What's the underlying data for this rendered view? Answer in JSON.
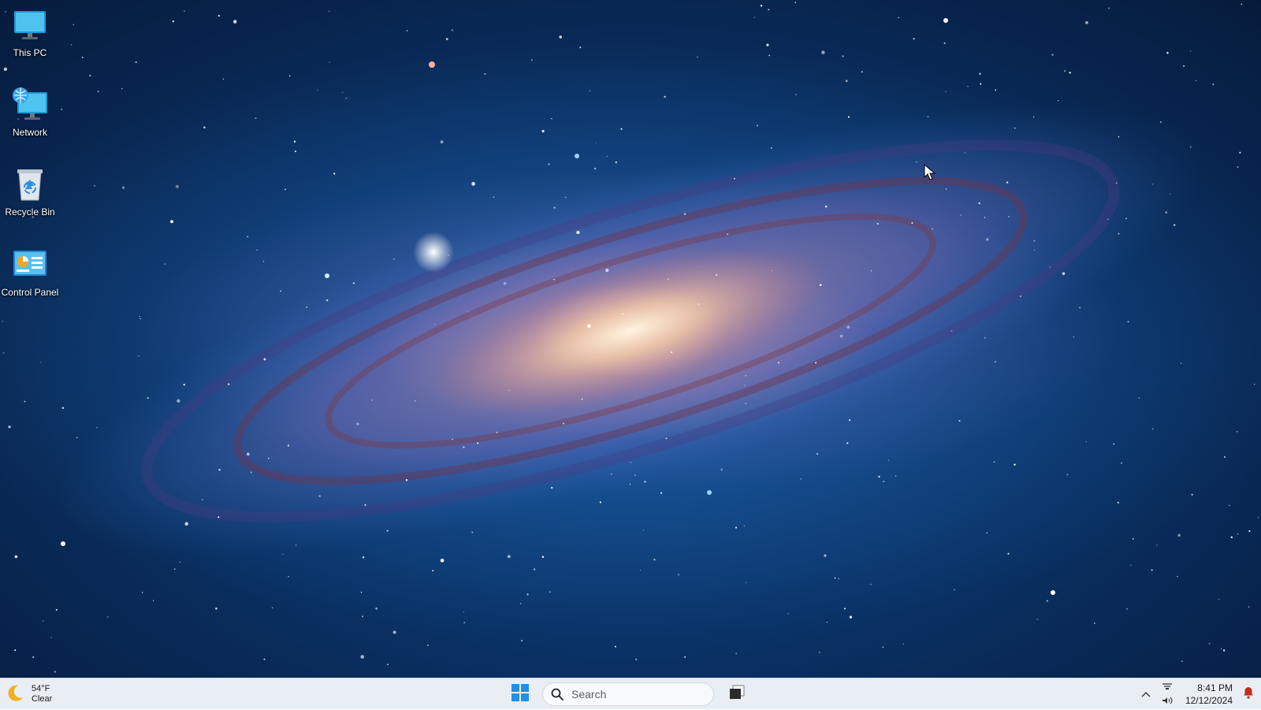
{
  "desktop": {
    "icons": [
      {
        "name": "this-pc",
        "label": "This PC",
        "icon": "monitor-icon"
      },
      {
        "name": "network",
        "label": "Network",
        "icon": "network-icon"
      },
      {
        "name": "recycle-bin",
        "label": "Recycle Bin",
        "icon": "recycle-bin-icon"
      },
      {
        "name": "control-panel",
        "label": "Control Panel",
        "icon": "control-panel-icon"
      }
    ]
  },
  "taskbar": {
    "weather": {
      "temperature": "54°F",
      "condition": "Clear",
      "icon": "moon-icon"
    },
    "start_icon": "windows-logo-icon",
    "search": {
      "placeholder": "Search",
      "value": ""
    },
    "task_view_icon": "task-view-icon",
    "tray": {
      "overflow_icon": "chevron-up-icon",
      "network_icon": "network-status-icon",
      "volume_icon": "volume-icon",
      "notification_icon": "bell-icon"
    },
    "clock": {
      "time": "8:41 PM",
      "date": "12/12/2024"
    }
  },
  "colors": {
    "taskbar_bg": "#e9eef4",
    "start_accent": "#1f8fe8",
    "notification_accent": "#c42b1c"
  }
}
